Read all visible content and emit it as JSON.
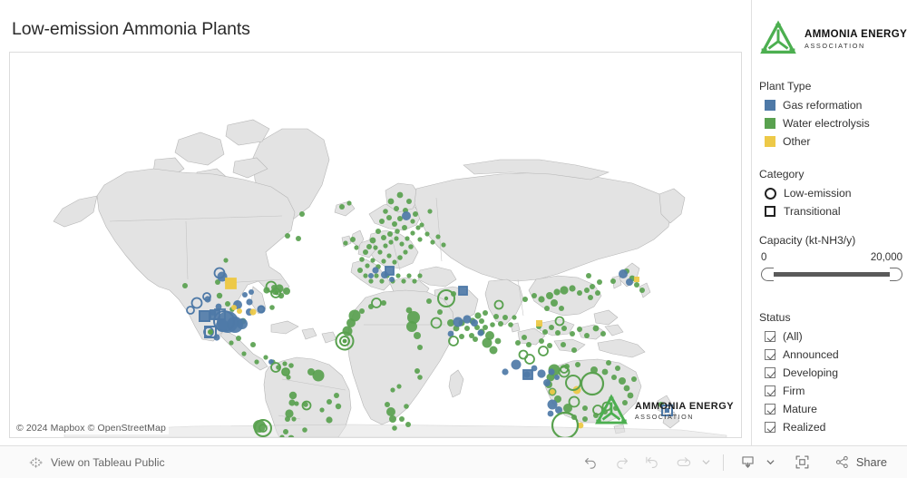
{
  "title": "Low-emission Ammonia Plants",
  "map": {
    "attribution": "© 2024 Mapbox  © OpenStreetMap",
    "watermark": {
      "title": "AMMONIA ENERGY",
      "subtitle": "ASSOCIATION"
    }
  },
  "legend": {
    "logo": {
      "title": "AMMONIA ENERGY",
      "subtitle": "ASSOCIATION"
    },
    "plant_type": {
      "heading": "Plant Type",
      "items": [
        {
          "label": "Gas reformation",
          "color": "#4e79a7"
        },
        {
          "label": "Water electrolysis",
          "color": "#59a14f"
        },
        {
          "label": "Other",
          "color": "#edc948"
        }
      ]
    },
    "category": {
      "heading": "Category",
      "items": [
        {
          "label": "Low-emission",
          "shape": "circle"
        },
        {
          "label": "Transitional",
          "shape": "square"
        }
      ]
    },
    "capacity": {
      "heading": "Capacity (kt-NH3/y)",
      "min_label": "0",
      "max_label": "20,000",
      "min_value": 0,
      "max_value": 20000
    },
    "status": {
      "heading": "Status",
      "items": [
        {
          "label": "(All)",
          "checked": true
        },
        {
          "label": "Announced",
          "checked": true
        },
        {
          "label": "Developing",
          "checked": true
        },
        {
          "label": "Firm",
          "checked": true
        },
        {
          "label": "Mature",
          "checked": true
        },
        {
          "label": "Realized",
          "checked": true
        }
      ]
    }
  },
  "toolbar": {
    "tableau_link_label": "View on Tableau Public",
    "share_label": "Share",
    "buttons": [
      {
        "name": "undo",
        "icon": "undo-icon",
        "enabled": true
      },
      {
        "name": "redo",
        "icon": "redo-icon",
        "enabled": false
      },
      {
        "name": "revert",
        "icon": "revert-icon",
        "enabled": false
      },
      {
        "name": "refresh",
        "icon": "refresh-icon",
        "enabled": false
      },
      {
        "name": "download",
        "icon": "download-icon",
        "enabled": true
      },
      {
        "name": "fullscreen",
        "icon": "fullscreen-icon",
        "enabled": true
      }
    ]
  }
}
